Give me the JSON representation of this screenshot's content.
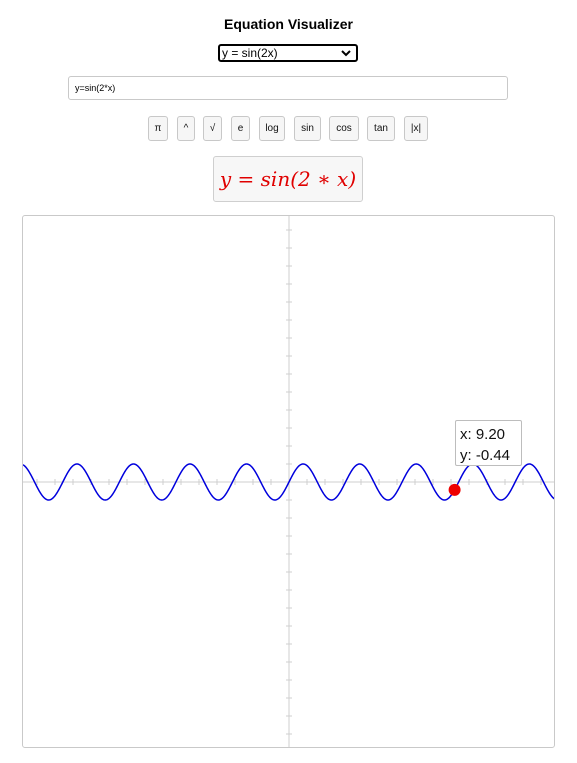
{
  "header": {
    "title": "Equation Visualizer"
  },
  "equation_select": {
    "selected": "y = sin(2x)"
  },
  "expression_input": {
    "value": "y=sin(2*x)"
  },
  "symbol_buttons": [
    {
      "id": "pi",
      "label": "π"
    },
    {
      "id": "power",
      "label": "^"
    },
    {
      "id": "sqrt",
      "label": "√"
    },
    {
      "id": "e",
      "label": "e"
    },
    {
      "id": "log",
      "label": "log"
    },
    {
      "id": "sin",
      "label": "sin"
    },
    {
      "id": "cos",
      "label": "cos"
    },
    {
      "id": "tan",
      "label": "tan"
    },
    {
      "id": "abs",
      "label": "|x|"
    }
  ],
  "rendered_equation": {
    "lhs": "y",
    "equals": "=",
    "rhs": "sin(2 ∗ x)"
  },
  "graph": {
    "expression": "sin(2x)",
    "line_color": "#0000dd",
    "marker_color": "#ee0000",
    "hover_point": {
      "x": 9.2,
      "y": -0.44
    },
    "tooltip": {
      "x_label": "x: 9.20",
      "y_label": "y: -0.44"
    }
  }
}
